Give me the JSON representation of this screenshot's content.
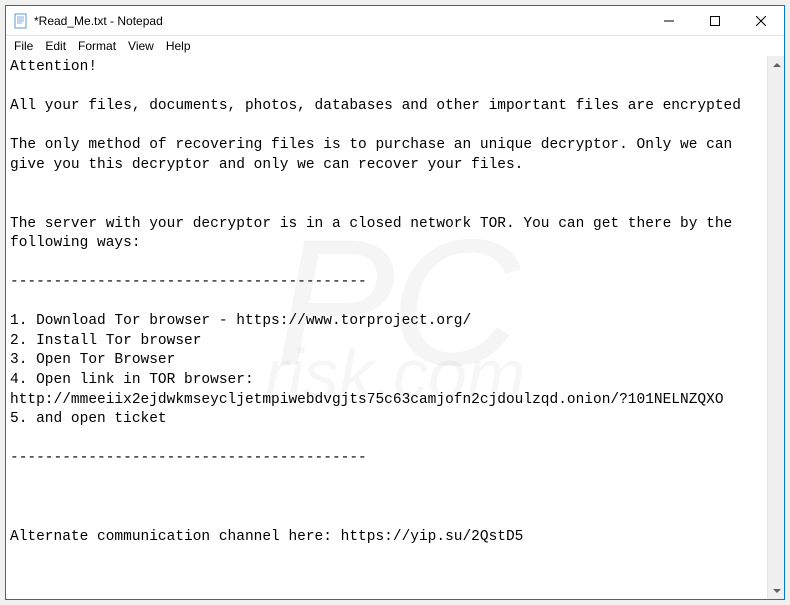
{
  "window": {
    "title": "*Read_Me.txt - Notepad"
  },
  "menu": {
    "file": "File",
    "edit": "Edit",
    "format": "Format",
    "view": "View",
    "help": "Help"
  },
  "document": {
    "text": "Attention!\n\nAll your files, documents, photos, databases and other important files are encrypted\n\nThe only method of recovering files is to purchase an unique decryptor. Only we can give you this decryptor and only we can recover your files.\n\n\nThe server with your decryptor is in a closed network TOR. You can get there by the following ways:\n\n-----------------------------------------\n\n1. Download Tor browser - https://www.torproject.org/\n2. Install Tor browser\n3. Open Tor Browser\n4. Open link in TOR browser: http://mmeeiix2ejdwkmseycljetmpiwebdvgjts75c63camjofn2cjdoulzqd.onion/?101NELNZQXO\n5. and open ticket\n\n-----------------------------------------\n\n\n\nAlternate communication channel here: https://yip.su/2QstD5"
  },
  "watermark": {
    "main": "PC",
    "sub": "risk.com"
  }
}
